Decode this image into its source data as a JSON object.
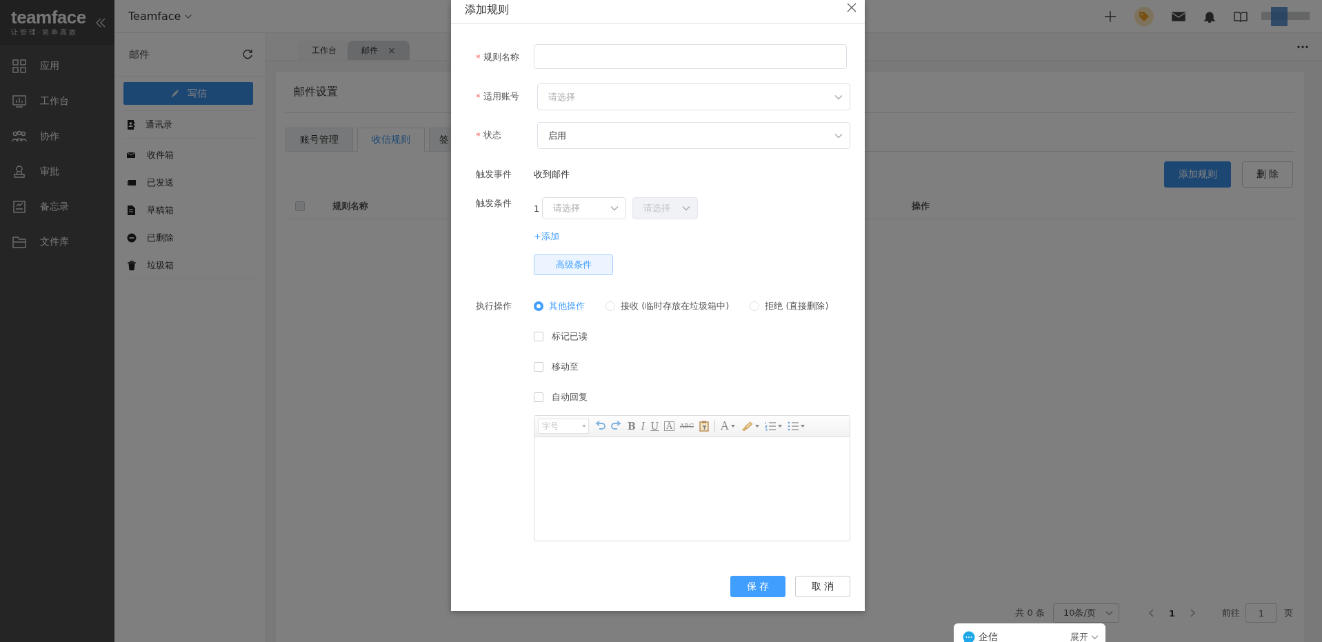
{
  "app": {
    "logo": "teamface",
    "slogan": "让管理·简单高效",
    "workspace": "Teamface"
  },
  "nav": [
    {
      "label": "应用"
    },
    {
      "label": "工作台"
    },
    {
      "label": "协作"
    },
    {
      "label": "审批"
    },
    {
      "label": "备忘录"
    },
    {
      "label": "文件库"
    }
  ],
  "mail_panel": {
    "title": "邮件",
    "compose": "写信",
    "contacts": "通讯录",
    "folders": [
      {
        "label": "收件箱"
      },
      {
        "label": "已发送"
      },
      {
        "label": "草稿箱"
      },
      {
        "label": "已删除"
      },
      {
        "label": "垃圾箱"
      }
    ]
  },
  "page_tabs": [
    {
      "label": "工作台",
      "selected": false
    },
    {
      "label": "邮件",
      "selected": true,
      "close": "×"
    }
  ],
  "settings": {
    "title": "邮件设置",
    "tabs": [
      {
        "label": "账号管理",
        "selected": false
      },
      {
        "label": "收信规则",
        "selected": true
      },
      {
        "label": "签",
        "selected": false
      }
    ],
    "actions": [
      {
        "label": "添加规则",
        "kind": "primary"
      },
      {
        "label": "删 除",
        "kind": "default"
      }
    ],
    "table": {
      "select_all": {
        "checked": false
      },
      "columns": [
        "规则名称",
        "操作"
      ]
    },
    "pagination": {
      "total": "共 0 条",
      "page_size": "10条/页",
      "pages": [
        {
          "label": "1",
          "selected": true
        }
      ],
      "goto": "前往",
      "goto_value": "1",
      "suffix": "页"
    }
  },
  "modal": {
    "title": "添加规则",
    "fields": [
      {
        "kind": "input",
        "label": "规则名称",
        "required_mark": "*"
      },
      {
        "kind": "select",
        "label": "适用账号",
        "required_mark": "*",
        "placeholder": "请选择"
      },
      {
        "kind": "select",
        "label": "状态",
        "required_mark": "*",
        "value": "启用"
      },
      {
        "kind": "static",
        "label": "触发事件",
        "value": "收到邮件"
      },
      {
        "kind": "conditions",
        "label": "触发条件",
        "conditions": [
          {
            "index": "1",
            "field": {
              "placeholder": "请选择",
              "disabled": false
            },
            "operator": {
              "placeholder": "请选择",
              "disabled": true
            }
          }
        ],
        "add_link": "+添加",
        "advanced_button": "高级条件"
      },
      {
        "kind": "actions",
        "label": "执行操作",
        "radios": [
          {
            "label": "其他操作",
            "selected": true
          },
          {
            "label": "接收 (临时存放在垃圾箱中)",
            "selected": false
          },
          {
            "label": "拒绝 (直接删除)",
            "selected": false
          }
        ],
        "checkboxes": [
          {
            "label": "标记已读",
            "checked": false
          },
          {
            "label": "移动至",
            "checked": false
          },
          {
            "label": "自动回复",
            "checked": false
          }
        ],
        "editor": {
          "font_size": {
            "placeholder": "字号"
          },
          "toolbar": [
            {
              "kind": "undo"
            },
            {
              "kind": "redo"
            },
            {
              "kind": "bold",
              "text": "B"
            },
            {
              "kind": "italic",
              "text": "I"
            },
            {
              "kind": "underline",
              "text": "U"
            },
            {
              "kind": "boxed",
              "text": "A"
            },
            {
              "kind": "strike",
              "text": "ABC"
            },
            {
              "kind": "paste"
            },
            {
              "kind": "separator"
            },
            {
              "kind": "font-color",
              "text": "A",
              "dropdown": true
            },
            {
              "kind": "highlight",
              "dropdown": true
            },
            {
              "kind": "ordered-list",
              "dropdown": true
            },
            {
              "kind": "bullet-list",
              "dropdown": true
            }
          ]
        }
      }
    ],
    "buttons": [
      {
        "label": "保 存",
        "kind": "primary"
      },
      {
        "label": "取 消",
        "kind": "default"
      }
    ]
  },
  "chat_widget": {
    "label": "企信",
    "toggle": "展开"
  }
}
